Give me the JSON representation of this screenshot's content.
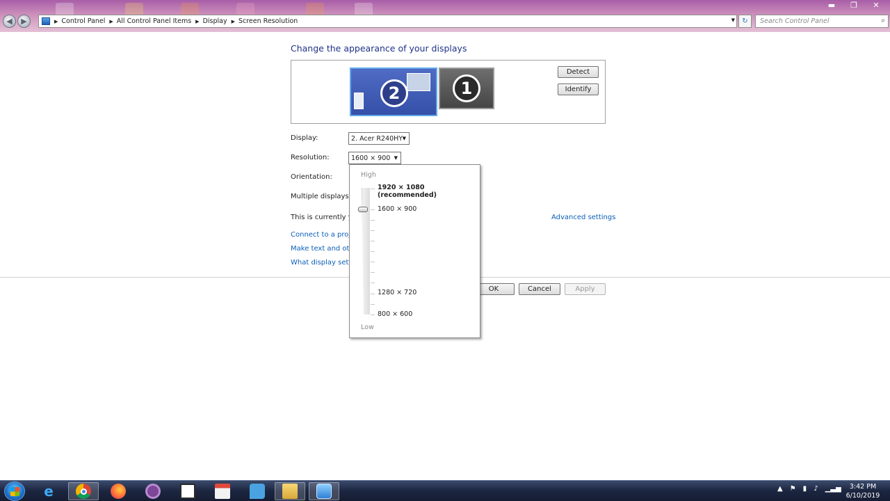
{
  "window": {
    "address": [
      "Control Panel",
      "All Control Panel Items",
      "Display",
      "Screen Resolution"
    ],
    "search_placeholder": "Search Control Panel",
    "minimize": "▬",
    "restore": "❐",
    "close": "✕"
  },
  "main": {
    "heading": "Change the appearance of your displays",
    "monitors": [
      {
        "number": "2",
        "selected": true
      },
      {
        "number": "1",
        "selected": false
      }
    ],
    "detect_label": "Detect",
    "identify_label": "Identify",
    "display_label": "Display:",
    "display_value": "2. Acer R240HY",
    "resolution_label": "Resolution:",
    "resolution_value": "1600 × 900",
    "orientation_label": "Orientation:",
    "multiple_displays_label": "Multiple displays:",
    "current_text": "This is currently you",
    "advanced_settings": "Advanced settings",
    "links": [
      "Connect to a projec",
      "Make text and other",
      "What display setting"
    ],
    "ok_label": "OK",
    "cancel_label": "Cancel",
    "apply_label": "Apply"
  },
  "resolution_popup": {
    "high_label": "High",
    "low_label": "Low",
    "options": [
      "1920 × 1080 (recommended)",
      "1600 × 900",
      "1280 × 720",
      "800 × 600"
    ],
    "selected": "1600 × 900"
  },
  "taskbar": {
    "apps": [
      "internet-explorer",
      "chrome",
      "firefox",
      "tor-browser",
      "notepad-app",
      "calendar-app",
      "messenger",
      "file-explorer",
      "control-panel"
    ],
    "time": "3:42 PM",
    "date": "6/10/2019"
  }
}
